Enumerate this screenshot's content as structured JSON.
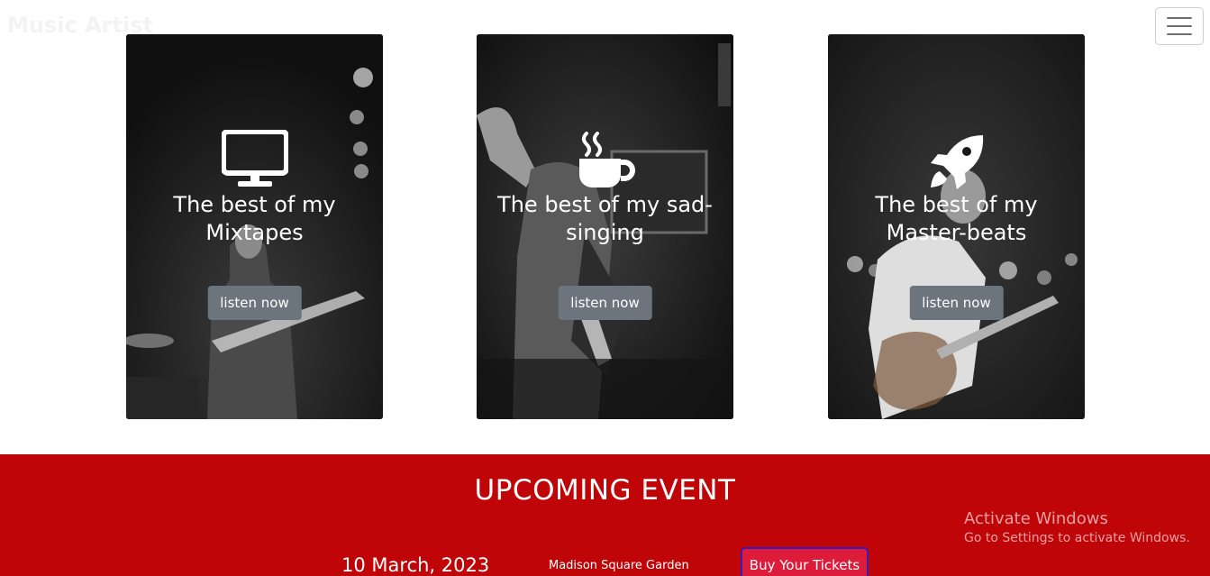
{
  "navbar": {
    "brand": "Music Artist",
    "toggler_icon": "hamburger-menu-icon"
  },
  "cards": [
    {
      "icon": "desktop-monitor-icon",
      "title": "The best of my Mixtapes",
      "button": "listen now"
    },
    {
      "icon": "coffee-cup-icon",
      "title": "The best of my sad-singing",
      "button": "listen now"
    },
    {
      "icon": "rocket-icon",
      "title": "The best of my Master-beats",
      "button": "listen now"
    }
  ],
  "event": {
    "heading": "UPCOMING EVENT",
    "date": "10 March, 2023",
    "venue": "Madison Square Garden",
    "button": "Buy Your Tickets",
    "background_color": "#bf0508",
    "button_color": "#dc1c3a"
  },
  "watermark": {
    "line1": "Activate Windows",
    "line2": "Go to Settings to activate Windows."
  }
}
